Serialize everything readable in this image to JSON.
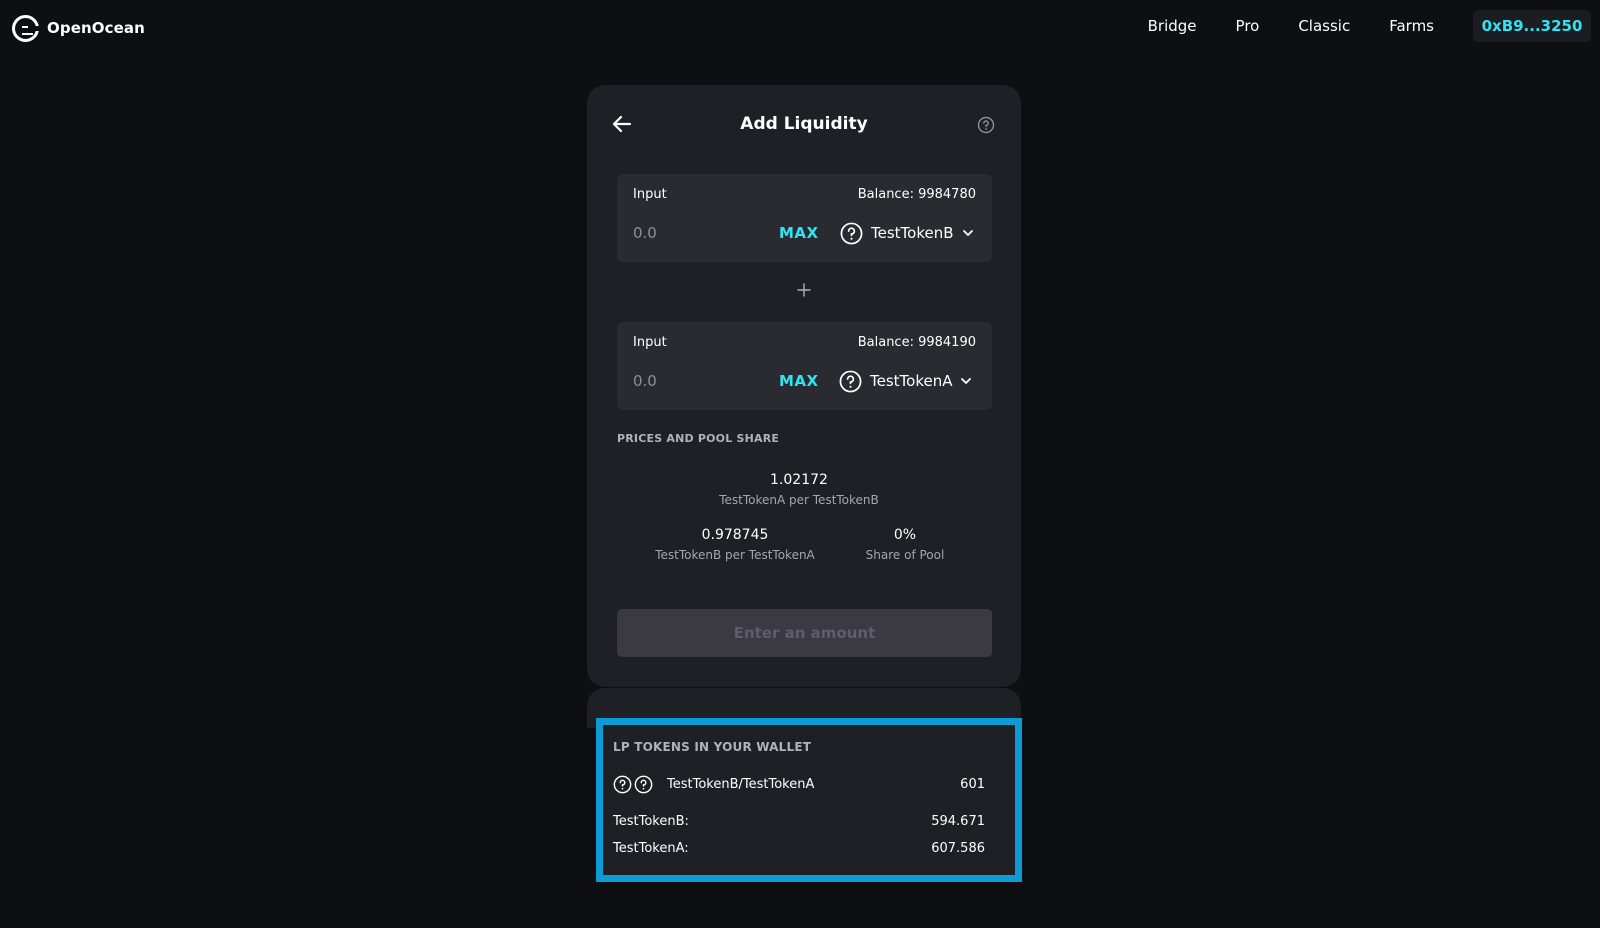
{
  "app": {
    "logo_text": "OpenOcean"
  },
  "nav": {
    "links": [
      "Bridge",
      "Pro",
      "Classic",
      "Farms"
    ],
    "wallet": "0xB9...3250"
  },
  "card": {
    "title": "Add Liquidity",
    "inputs": [
      {
        "label": "Input",
        "balance": "Balance: 9984780",
        "placeholder": "0.0",
        "max_label": "MAX",
        "token": "TestTokenB"
      },
      {
        "label": "Input",
        "balance": "Balance: 9984190",
        "placeholder": "0.0",
        "max_label": "MAX",
        "token": "TestTokenA"
      }
    ],
    "prices_title": "PRICES AND POOL SHARE",
    "prices": [
      {
        "value": "1.02172",
        "label": "TestTokenA per TestTokenB"
      },
      {
        "value": "0.978745",
        "label": "TestTokenB per TestTokenA"
      },
      {
        "value": "0%",
        "label": "Share of Pool"
      }
    ],
    "submit_label": "Enter an amount"
  },
  "lp": {
    "title": "LP TOKENS IN YOUR WALLET",
    "pair": "TestTokenB/TestTokenA",
    "pair_amount": "601",
    "rows": [
      {
        "label": "TestTokenB:",
        "value": "594.671"
      },
      {
        "label": "TestTokenA:",
        "value": "607.586"
      }
    ]
  },
  "colors": {
    "accent": "#2ee5f3",
    "highlight_border": "#0c9bd5",
    "background": "#0e0f13",
    "card": "#1f2025"
  }
}
